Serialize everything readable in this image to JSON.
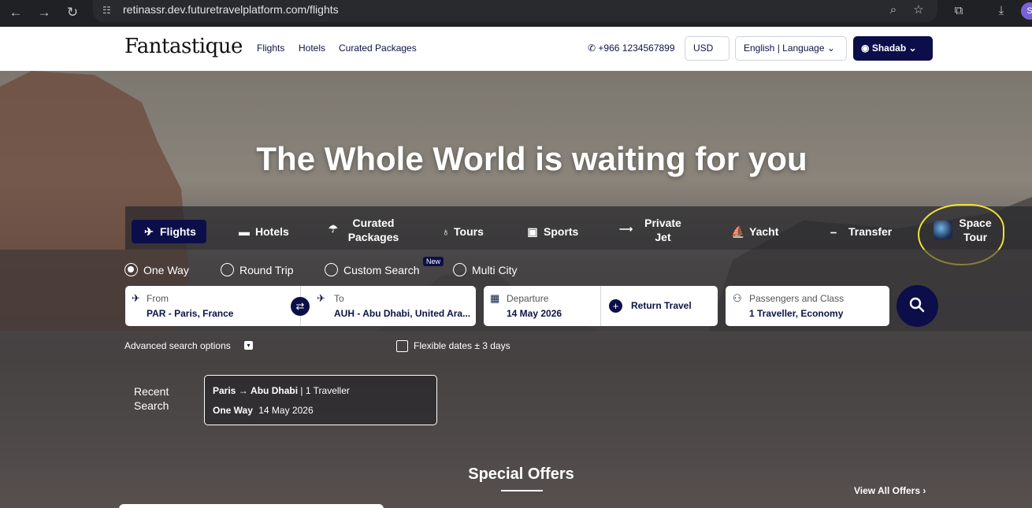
{
  "browser": {
    "url": "retinassr.dev.futuretravelplatform.com/flights",
    "back_icon": "arrow-left-icon",
    "forward_icon": "arrow-right-icon",
    "reload_icon": "reload-icon",
    "profile_initial": "S"
  },
  "header": {
    "logo": "Fantastique",
    "nav": [
      "Flights",
      "Hotels",
      "Curated Packages"
    ],
    "phone": "+966 1234567899",
    "currency": "USD",
    "language": "English | Language",
    "user": "Shadab"
  },
  "hero": {
    "title": "The Whole World is waiting for you"
  },
  "tabs": [
    {
      "label": "Flights",
      "icon": "plane-icon"
    },
    {
      "label": "Hotels",
      "icon": "bed-icon"
    },
    {
      "label": "Curated",
      "label2": "Packages",
      "icon": "packages-icon"
    },
    {
      "label": "Tours",
      "icon": "pin-icon"
    },
    {
      "label": "Sports",
      "icon": "sports-icon"
    },
    {
      "label": "Private",
      "label2": "Jet",
      "icon": "jet-icon"
    },
    {
      "label": "Yacht",
      "icon": "yacht-icon"
    },
    {
      "label": "Transfer",
      "icon": "car-icon"
    },
    {
      "label": "Space",
      "label2": "Tour",
      "icon": "space-icon"
    }
  ],
  "trip_types": [
    "One Way",
    "Round Trip",
    "Custom Search",
    "Multi City"
  ],
  "new_badge": "New",
  "search": {
    "from_label": "From",
    "from_value": "PAR - Paris, France",
    "to_label": "To",
    "to_value": "AUH - Abu Dhabi, United Ara...",
    "departure_label": "Departure",
    "departure_value": "14 May 2026",
    "return_label": "Return Travel",
    "pax_label": "Passengers and Class",
    "pax_value": "1 Traveller, Economy"
  },
  "advanced_label": "Advanced search options",
  "flexible_label": "Flexible dates ± 3 days",
  "recent": {
    "label1": "Recent",
    "label2": "Search",
    "from": "Paris",
    "arrow": "→",
    "to": "Abu Dhabi",
    "travellers": "| 1 Traveller",
    "type": "One Way",
    "date": "14 May 2026"
  },
  "special_offers": "Special Offers",
  "view_all": "View All Offers",
  "colors": {
    "brand_navy": "#0c0e4a",
    "highlight_yellow": "#f0e23a"
  }
}
